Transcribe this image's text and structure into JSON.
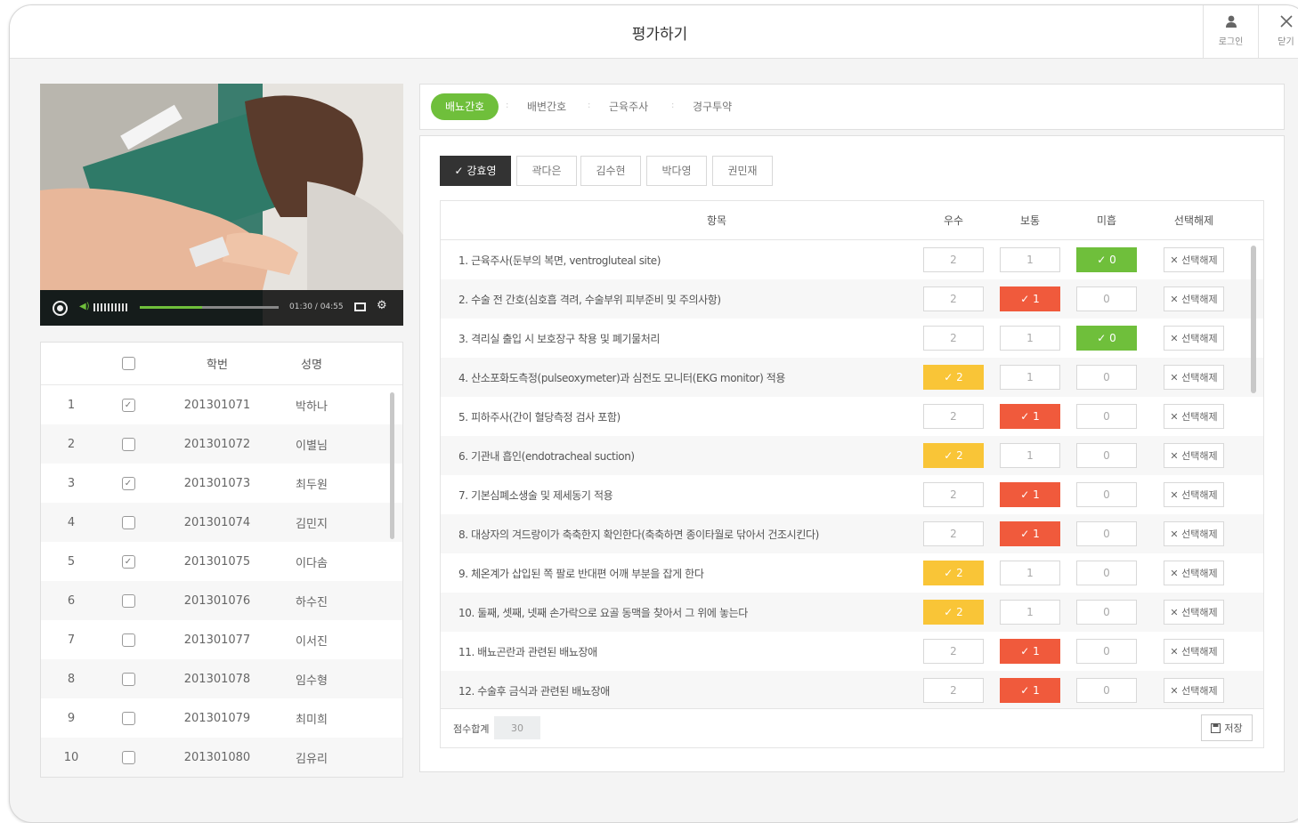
{
  "title": "평가하기",
  "titlebar": {
    "login_icon": "person-icon",
    "login_label": "로그인",
    "close_icon": "close-icon",
    "close_label": "닫기"
  },
  "video": {
    "time": "01:30 / 04:55",
    "progress_fraction": 0.45
  },
  "students": {
    "headers": {
      "number": "학번",
      "name": "성명"
    },
    "rows": [
      {
        "idx": "1",
        "checked": true,
        "number": "201301071",
        "name": "박하나"
      },
      {
        "idx": "2",
        "checked": false,
        "number": "201301072",
        "name": "이별님"
      },
      {
        "idx": "3",
        "checked": true,
        "number": "201301073",
        "name": "최두원"
      },
      {
        "idx": "4",
        "checked": false,
        "number": "201301074",
        "name": "김민지"
      },
      {
        "idx": "5",
        "checked": true,
        "number": "201301075",
        "name": "이다솜"
      },
      {
        "idx": "6",
        "checked": false,
        "number": "201301076",
        "name": "하수진"
      },
      {
        "idx": "7",
        "checked": false,
        "number": "201301077",
        "name": "이서진"
      },
      {
        "idx": "8",
        "checked": false,
        "number": "201301078",
        "name": "임수형"
      },
      {
        "idx": "9",
        "checked": false,
        "number": "201301079",
        "name": "최미희"
      },
      {
        "idx": "10",
        "checked": false,
        "number": "201301080",
        "name": "김유리"
      }
    ]
  },
  "categories": [
    {
      "label": "배뇨간호",
      "active": true
    },
    {
      "label": "배변간호",
      "active": false
    },
    {
      "label": "근육주사",
      "active": false
    },
    {
      "label": "경구투약",
      "active": false
    }
  ],
  "student_tabs": [
    {
      "label": "강효영",
      "active": true
    },
    {
      "label": "곽다은",
      "active": false
    },
    {
      "label": "김수현",
      "active": false
    },
    {
      "label": "박다영",
      "active": false
    },
    {
      "label": "권민재",
      "active": false
    }
  ],
  "table": {
    "headers": {
      "item": "항목",
      "excellent": "우수",
      "average": "보통",
      "poor": "미흡",
      "deselect": "선택해제"
    },
    "deselect_label": "선택해제",
    "rows": [
      {
        "item": "1. 근육주사(둔부의 복면, ventrogluteal site)",
        "excellent": "2",
        "average": "1",
        "poor": "0",
        "selected": "poor"
      },
      {
        "item": "2. 수술 전 간호(심호흡 격려, 수술부위 피부준비 및 주의사항)",
        "excellent": "2",
        "average": "1",
        "poor": "0",
        "selected": "average"
      },
      {
        "item": "3. 격리실 출입 시 보호장구 착용 및 폐기물처리",
        "excellent": "2",
        "average": "1",
        "poor": "0",
        "selected": "poor"
      },
      {
        "item": "4. 산소포화도측정(pulseoxymeter)과 심전도 모니터(EKG monitor) 적용",
        "excellent": "2",
        "average": "1",
        "poor": "0",
        "selected": "excellent"
      },
      {
        "item": "5. 피하주사(간이 혈당측정 검사 포함)",
        "excellent": "2",
        "average": "1",
        "poor": "0",
        "selected": "average"
      },
      {
        "item": "6. 기관내 흡인(endotracheal suction)",
        "excellent": "2",
        "average": "1",
        "poor": "0",
        "selected": "excellent"
      },
      {
        "item": "7. 기본심폐소생술 및 제세동기 적용",
        "excellent": "2",
        "average": "1",
        "poor": "0",
        "selected": "average"
      },
      {
        "item": "8.  대상자의 겨드랑이가 축축한지 확인한다(축축하면 종이타월로 닦아서 건조시킨다)",
        "excellent": "2",
        "average": "1",
        "poor": "0",
        "selected": "average"
      },
      {
        "item": "9. 체온계가 삽입된 쪽 팔로 반대편 어깨 부분을 잡게 한다",
        "excellent": "2",
        "average": "1",
        "poor": "0",
        "selected": "excellent"
      },
      {
        "item": "10. 둘째, 셋째, 넷째 손가락으로 요골 동맥을 찾아서 그 위에 놓는다",
        "excellent": "2",
        "average": "1",
        "poor": "0",
        "selected": "excellent"
      },
      {
        "item": "11. 배뇨곤란과 관련된 배뇨장애",
        "excellent": "2",
        "average": "1",
        "poor": "0",
        "selected": "average"
      },
      {
        "item": "12. 수술후 금식과 관련된 배뇨장애",
        "excellent": "2",
        "average": "1",
        "poor": "0",
        "selected": "average"
      }
    ],
    "total_label": "점수합계",
    "total_value": "30",
    "save_label": "저장",
    "save_icon": "floppy-icon"
  },
  "colors": {
    "accent_green": "#6fbf3b",
    "excellent_yellow": "#f9c537",
    "average_red": "#f05a3c"
  }
}
